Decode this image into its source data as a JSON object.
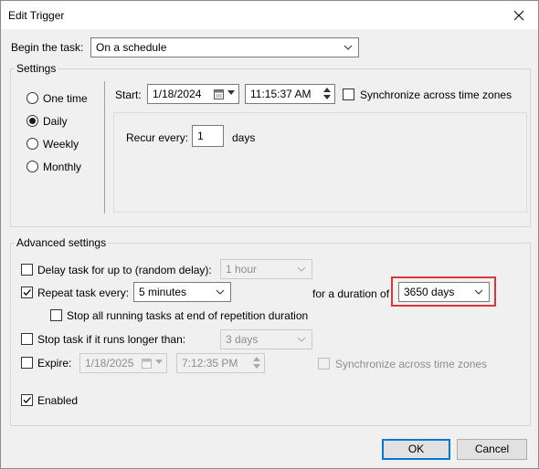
{
  "window": {
    "title": "Edit Trigger"
  },
  "begin_task": {
    "label": "Begin the task:",
    "value": "On a schedule"
  },
  "settings": {
    "group_label": "Settings",
    "schedule_options": [
      {
        "label": "One time",
        "selected": false
      },
      {
        "label": "Daily",
        "selected": true
      },
      {
        "label": "Weekly",
        "selected": false
      },
      {
        "label": "Monthly",
        "selected": false
      }
    ],
    "start_label": "Start:",
    "start_date": "1/18/2024",
    "start_time": "11:15:37 AM",
    "sync_label": "Synchronize across time zones",
    "sync_checked": false,
    "recur_label": "Recur every:",
    "recur_value": "1",
    "recur_unit": "days"
  },
  "advanced": {
    "group_label": "Advanced settings",
    "delay": {
      "label": "Delay task for up to (random delay):",
      "value": "1 hour",
      "checked": false
    },
    "repeat": {
      "label": "Repeat task every:",
      "value": "5 minutes",
      "checked": true,
      "duration_label": "for a duration of",
      "duration_value": "3650 days"
    },
    "stop_running": {
      "label": "Stop all running tasks at end of repetition duration",
      "checked": false
    },
    "stop_longer": {
      "label": "Stop task if it runs longer than:",
      "value": "3 days",
      "checked": false
    },
    "expire": {
      "label": "Expire:",
      "date": "1/18/2025",
      "time": "7:12:35 PM",
      "checked": false,
      "sync_label": "Synchronize across time zones"
    },
    "enabled": {
      "label": "Enabled",
      "checked": true
    }
  },
  "buttons": {
    "ok": "OK",
    "cancel": "Cancel"
  },
  "colors": {
    "highlight": "#d9363e",
    "accent": "#0078d7"
  }
}
